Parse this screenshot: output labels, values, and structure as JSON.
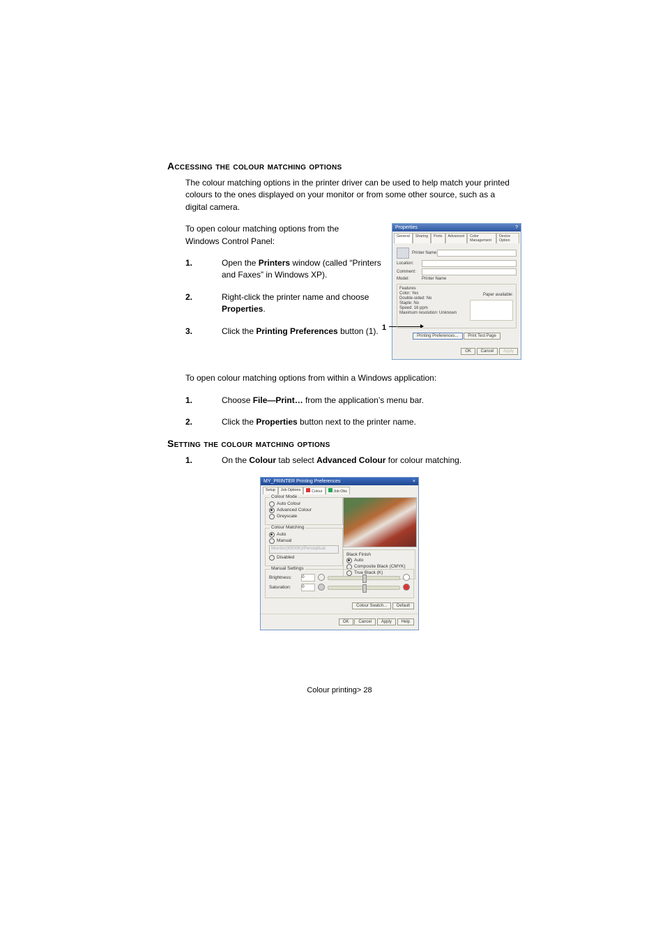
{
  "section1": {
    "title": "Accessing the colour matching options",
    "intro": "The colour matching options in the printer driver can be used to help match your printed colours to the ones displayed on your monitor or from some other source, such as a digital camera.",
    "lead": "To open colour matching options from the Windows Control Panel:",
    "items": [
      {
        "num": "1.",
        "before": "Open the ",
        "bold": "Printers",
        "after": " window (called “Printers and Faxes” in Windows XP)."
      },
      {
        "num": "2.",
        "before": "Right-click the printer name and choose ",
        "bold": "Properties",
        "after": "."
      },
      {
        "num": "3.",
        "before": "Click the ",
        "bold": "Printing Preferences",
        "after": " button (1)."
      }
    ],
    "callout": "1"
  },
  "dialog1": {
    "title": "Properties",
    "tabs": [
      "General",
      "Sharing",
      "Ports",
      "Advanced",
      "Color Management",
      "Device Option"
    ],
    "printer_name_label": "Printer Name",
    "location_label": "Location:",
    "comment_label": "Comment:",
    "model_label": "Model:",
    "model_value": "Printer Name",
    "features_label": "Features",
    "feat": {
      "color": "Color: Yes",
      "double": "Double-sided: No",
      "staple": "Staple: No",
      "speed": "Speed: 16 ppm",
      "max": "Maximum resolution: Unknown",
      "paper": "Paper available:"
    },
    "pref_btn": "Printing Preferences...",
    "test_btn": "Print Test Page",
    "ok": "OK",
    "cancel": "Cancel",
    "apply": "Apply"
  },
  "section_mid": {
    "lead": "To open colour matching options from within a Windows application:",
    "items": [
      {
        "num": "1.",
        "before": "Choose ",
        "bold": "File—Print…",
        "after": " from the application’s menu bar."
      },
      {
        "num": "2.",
        "before": "Click the ",
        "bold": "Properties",
        "after": " button next to the printer name."
      }
    ]
  },
  "section2": {
    "title": "Setting the colour matching options",
    "item": {
      "num": "1.",
      "before": "On the ",
      "bold1": "Colour",
      "mid": " tab select ",
      "bold2": "Advanced Colour",
      "after": " for colour matching."
    }
  },
  "prefs": {
    "title": "MY_PRINTER Printing Preferences",
    "tabs": [
      "Setup",
      "Job Options",
      "Colour",
      "Job Obs"
    ],
    "colour_mode": {
      "legend": "Colour Mode",
      "auto": "Auto Colour",
      "adv": "Advanced Colour",
      "gray": "Greyscale"
    },
    "matching": {
      "legend": "Colour Matching",
      "auto": "Auto",
      "manual": "Manual",
      "dropdown": "Monitor(6500K)/Perceptual",
      "disabled": "Disabled"
    },
    "black": {
      "legend": "Black Finish",
      "auto": "Auto",
      "comp": "Composite Black (CMYK)",
      "true": "True Black (K)"
    },
    "manual": {
      "legend": "Manual Settings",
      "brightness": "Brightness:",
      "saturation": "Saturation:",
      "bval": "0",
      "sval": "0"
    },
    "swatch": "Colour Swatch...",
    "default": "Default",
    "ok": "OK",
    "cancel": "Cancel",
    "apply": "Apply",
    "help": "Help"
  },
  "footer": "Colour printing> 28"
}
